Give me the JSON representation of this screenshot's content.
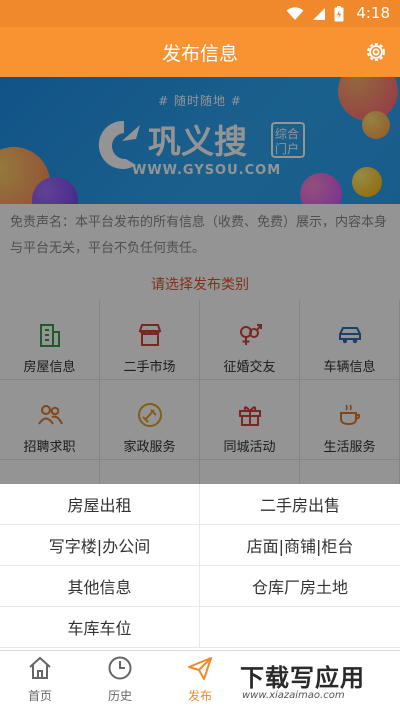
{
  "status": {
    "time": "4:18"
  },
  "header": {
    "title": "发布信息"
  },
  "banner": {
    "tagline": "#  随时随地  #",
    "brand_name": "巩义搜",
    "brand_sub": "综合门户",
    "url": "WWW.GYSOU.COM"
  },
  "disclaimer": "免责声名：本平台发布的所有信息（收费、免费）展示，内容本身与平台无关，平台不负任何责任。",
  "chooser": "请选择发布类别",
  "categories": [
    {
      "label": "房屋信息",
      "icon": "building-icon"
    },
    {
      "label": "二手市场",
      "icon": "shop-icon"
    },
    {
      "label": "征婚交友",
      "icon": "gender-icon"
    },
    {
      "label": "车辆信息",
      "icon": "car-icon"
    },
    {
      "label": "招聘求职",
      "icon": "people-icon"
    },
    {
      "label": "家政服务",
      "icon": "cleaning-icon"
    },
    {
      "label": "同城活动",
      "icon": "gift-icon"
    },
    {
      "label": "生活服务",
      "icon": "coffee-icon"
    }
  ],
  "sheet_options": [
    "房屋出租",
    "二手房出售",
    "写字楼|办公间",
    "店面|商铺|柜台",
    "其他信息",
    "仓库厂房土地",
    "车库车位"
  ],
  "tabs": [
    {
      "label": "首页",
      "icon": "home-icon"
    },
    {
      "label": "历史",
      "icon": "clock-icon"
    },
    {
      "label": "发布",
      "icon": "send-icon"
    }
  ],
  "watermark": {
    "big": "下载写应用",
    "small": "www.xiazaimao.com"
  },
  "colors": {
    "accent": "#f79331",
    "highlight": "#e0542c"
  }
}
